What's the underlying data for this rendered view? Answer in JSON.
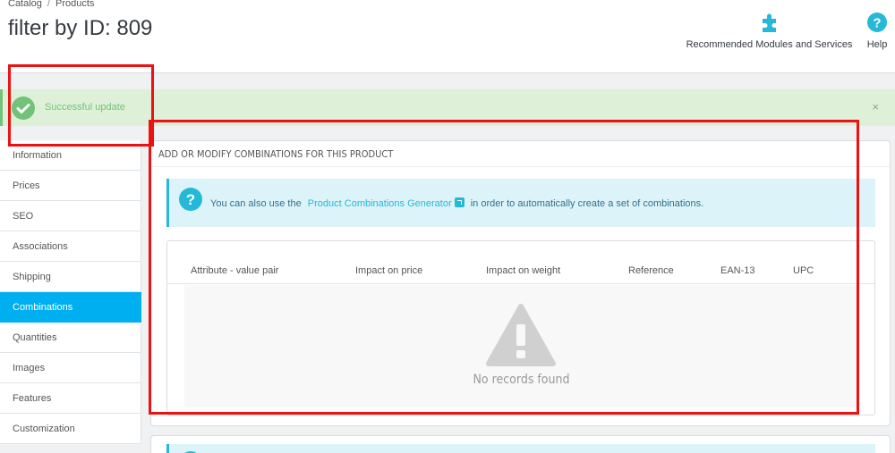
{
  "breadcrumb": {
    "items": [
      "Catalog",
      "Products"
    ],
    "separator": "/"
  },
  "page_title": "filter by ID: 809",
  "toolbar": {
    "modules_label": "Recommended Modules and Services",
    "modules_icon": "puzzle-icon",
    "help_label": "Help",
    "help_icon": "question-circle-icon"
  },
  "alert": {
    "message": "Successful update",
    "close": "×"
  },
  "sidebar": {
    "tabs": [
      {
        "label": "Information"
      },
      {
        "label": "Prices"
      },
      {
        "label": "SEO"
      },
      {
        "label": "Associations"
      },
      {
        "label": "Shipping"
      },
      {
        "label": "Combinations"
      },
      {
        "label": "Quantities"
      },
      {
        "label": "Images"
      },
      {
        "label": "Features"
      },
      {
        "label": "Customization"
      }
    ],
    "active": "Combinations"
  },
  "combinations_panel": {
    "heading": "ADD OR MODIFY COMBINATIONS FOR THIS PRODUCT",
    "info": {
      "before": "You can also use the",
      "link": "Product Combinations Generator",
      "after": "in order to automatically create a set of combinations."
    },
    "table": {
      "columns": [
        "Attribute - value pair",
        "Impact on price",
        "Impact on weight",
        "Reference",
        "EAN-13",
        "UPC"
      ],
      "empty_text": "No records found"
    }
  },
  "colors": {
    "accent": "#00aff0",
    "success": "#72c279",
    "info": "#25b9d7",
    "annotation": "#ee1111"
  }
}
